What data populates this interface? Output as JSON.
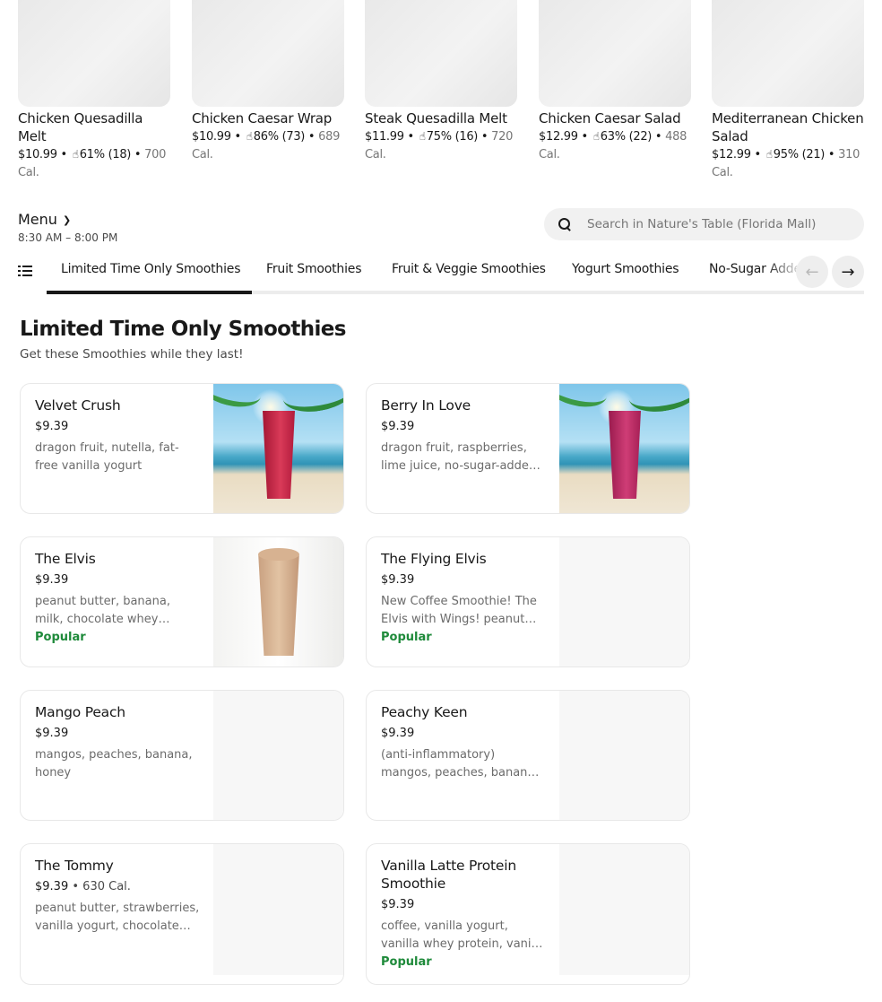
{
  "carousel": {
    "items": [
      {
        "name": "Chicken Quesadilla Melt",
        "price": "$10.99",
        "rating": "61% (18)",
        "cal": "700 Cal."
      },
      {
        "name": "Chicken Caesar Wrap",
        "price": "$10.99",
        "rating": "86% (73)",
        "cal": "689 Cal."
      },
      {
        "name": "Steak Quesadilla Melt",
        "price": "$11.99",
        "rating": "75% (16)",
        "cal": "720 Cal."
      },
      {
        "name": "Chicken Caesar Salad",
        "price": "$12.99",
        "rating": "63% (22)",
        "cal": "488 Cal."
      },
      {
        "name": "Mediterranean Chicken Salad",
        "price": "$12.99",
        "rating": "95% (21)",
        "cal": "310 Cal."
      }
    ],
    "separator": "•",
    "thumb_glyph": "👍"
  },
  "menu": {
    "title": "Menu",
    "hours": "8:30 AM – 8:00 PM"
  },
  "search": {
    "placeholder": "Search in Nature's Table (Florida Mall)"
  },
  "tabs": [
    {
      "label": "Limited Time Only Smoothies",
      "active": true
    },
    {
      "label": "Fruit Smoothies",
      "active": false
    },
    {
      "label": "Fruit & Veggie Smoothies",
      "active": false
    },
    {
      "label": "Yogurt Smoothies",
      "active": false
    },
    {
      "label": "No-Sugar Added Smoothies",
      "active": false
    }
  ],
  "nav_arrows": {
    "prev": "←",
    "next": "→"
  },
  "section": {
    "title": "Limited Time Only Smoothies",
    "subtitle": "Get these Smoothies while they last!"
  },
  "items": [
    {
      "name": "Velvet Crush",
      "price": "$9.39",
      "cal": "",
      "desc": "dragon fruit, nutella, fat-free vanilla yogurt",
      "badge": "",
      "image": "beach-red"
    },
    {
      "name": "Berry In Love",
      "price": "$9.39",
      "cal": "",
      "desc": "dragon fruit, raspberries, lime juice, no-sugar-added vanilla yogurt",
      "badge": "",
      "image": "beach-berry"
    },
    {
      "name": "The Elvis",
      "price": "$9.39",
      "cal": "",
      "desc": "peanut butter, banana, milk, chocolate whey protein, honey",
      "badge": "Popular",
      "image": "elvis"
    },
    {
      "name": "The Flying Elvis",
      "price": "$9.39",
      "cal": "",
      "desc": "New Coffee Smoothie! The Elvis with Wings! peanut butter, banana, coffee",
      "badge": "Popular",
      "image": "none"
    },
    {
      "name": "Mango Peach",
      "price": "$9.39",
      "cal": "",
      "desc": "mangos, peaches, banana, honey",
      "badge": "",
      "image": "none"
    },
    {
      "name": "Peachy Keen",
      "price": "$9.39",
      "cal": "",
      "desc": "(anti-inflammatory) mangos, peaches, banana, ginger, turmeric",
      "badge": "",
      "image": "none"
    },
    {
      "name": "The Tommy",
      "price": "$9.39",
      "cal": "630 Cal.",
      "desc": "peanut butter, strawberries, vanilla yogurt, chocolate whey protein",
      "badge": "",
      "image": "none"
    },
    {
      "name": "Vanilla Latte Protein Smoothie",
      "price": "$9.39",
      "cal": "",
      "desc": "coffee, vanilla yogurt, vanilla whey protein, vanilla syrup",
      "badge": "Popular",
      "image": "none"
    }
  ],
  "colors": {
    "popular": "#1e8a3a",
    "text": "#191919",
    "muted": "#767676"
  }
}
